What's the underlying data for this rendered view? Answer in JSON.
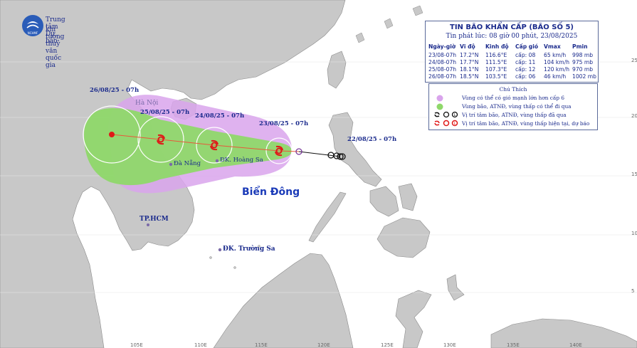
{
  "agency": {
    "line1": "Trung tâm Dự báo",
    "line2": "khí tượng thuỷ văn quốc gia",
    "logo_text": "NCHMF"
  },
  "bulletin": {
    "title": "TIN BÃO KHẨN CẤP (BÃO SỐ 5)",
    "issued": "Tin phát lúc: 08 giờ 00 phút, 23/08/2025",
    "columns": [
      "Ngày-giờ",
      "Vĩ độ",
      "Kinh độ",
      "Cấp gió",
      "Vmax",
      "Pmin"
    ],
    "rows": [
      [
        "23/08-07h",
        "17.2°N",
        "116.6°E",
        "cấp: 08",
        "65 km/h",
        "998 mb"
      ],
      [
        "24/08-07h",
        "17.7°N",
        "111.5°E",
        "cấp: 11",
        "104 km/h",
        "975 mb"
      ],
      [
        "25/08-07h",
        "18.1°N",
        "107.3°E",
        "cấp: 12",
        "120 km/h",
        "970 mb"
      ],
      [
        "26/08-07h",
        "18.5°N",
        "103.5°E",
        "cấp: 06",
        "46 km/h",
        "1002 mb"
      ]
    ]
  },
  "legend": {
    "title": "Chú Thích",
    "items": [
      "Vùng có thể có gió mạnh lớn hơn cấp 6",
      "Vùng bão, ATNĐ, vùng thấp có thể đi qua",
      "Vị trí tâm bão, ATNĐ, vùng thấp đã qua",
      "Vị trí tâm bão, ATNĐ, vùng thấp hiện tại, dự báo"
    ],
    "colors": {
      "strong_wind": "#d9a4ec",
      "track_area": "#8fd86a",
      "past_center": "#111111",
      "forecast_center": "#e01818"
    }
  },
  "places": {
    "hanoi": "Hà Nội",
    "danang": "Đà Nẵng",
    "hoangsa": "ĐK. Hoàng Sa",
    "hcm": "TP.HCM",
    "truongsa": "ĐK. Trường Sa",
    "biendong": "Biển Đông"
  },
  "time_labels": {
    "t22": "22/08/25 - 07h",
    "t23": "23/08/25 - 07h",
    "t24": "24/08/25 - 07h",
    "t25": "25/08/25 - 07h",
    "t26": "26/08/25 - 07h"
  },
  "axes": {
    "lat": [
      "25",
      "20",
      "15",
      "10",
      "5"
    ],
    "lon": [
      "105E",
      "110E",
      "115E",
      "120E",
      "125E",
      "130E",
      "135E",
      "140E"
    ]
  },
  "colors": {
    "land": "#c8c8c8",
    "sea": "#ffffff",
    "text_blue": "#1a2a8c",
    "track_line": "#e8583a"
  }
}
